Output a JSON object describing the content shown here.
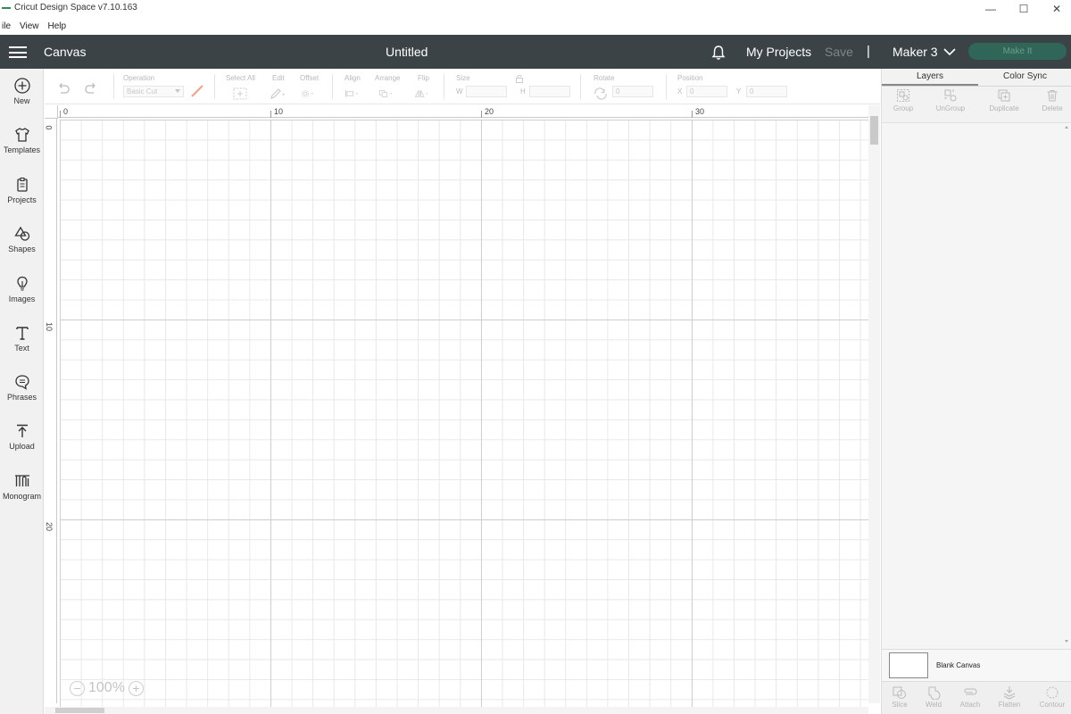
{
  "window": {
    "title": "Cricut Design Space  v7.10.163",
    "controls": [
      "—",
      "☐",
      "✕"
    ]
  },
  "menu": {
    "items": [
      "ile",
      "View",
      "Help"
    ]
  },
  "header": {
    "section": "Canvas",
    "project_name": "Untitled",
    "my_projects": "My Projects",
    "save": "Save",
    "separator": "|",
    "machine": "Maker 3",
    "make_it": "Make It",
    "colors": {
      "bar": "#3c4347",
      "make_it_bg": "#2f6657"
    }
  },
  "sidebar": {
    "items": [
      {
        "label": "New",
        "icon": "plus-circle-icon"
      },
      {
        "label": "Templates",
        "icon": "tshirt-icon"
      },
      {
        "label": "Projects",
        "icon": "clipboard-icon"
      },
      {
        "label": "Shapes",
        "icon": "shapes-icon"
      },
      {
        "label": "Images",
        "icon": "lightbulb-icon"
      },
      {
        "label": "Text",
        "icon": "text-icon"
      },
      {
        "label": "Phrases",
        "icon": "speech-bubble-icon"
      },
      {
        "label": "Upload",
        "icon": "upload-icon"
      },
      {
        "label": "Monogram",
        "icon": "monogram-icon"
      }
    ]
  },
  "toolbar": {
    "operation_label": "Operation",
    "operation_value": "Basic Cut",
    "select_all": "Select All",
    "edit": "Edit",
    "offset": "Offset",
    "align": "Align",
    "arrange": "Arrange",
    "flip": "Flip",
    "size": "Size",
    "size_w": "W",
    "size_h": "H",
    "rotate": "Rotate",
    "rotate_value": "0",
    "position": "Position",
    "pos_x": "X",
    "pos_y": "Y",
    "pos_x_value": "0",
    "pos_y_value": "0"
  },
  "canvas": {
    "ruler_top": [
      "0",
      "10",
      "20",
      "30"
    ],
    "ruler_left": [
      "0",
      "10",
      "20"
    ],
    "zoom": "100%"
  },
  "right_panel": {
    "tabs": [
      "Layers",
      "Color Sync"
    ],
    "actions": [
      "Group",
      "UnGroup",
      "Duplicate",
      "Delete"
    ],
    "blank_canvas": "Blank Canvas",
    "bottom_actions": [
      "Slice",
      "Weld",
      "Attach",
      "Flatten",
      "Contour"
    ]
  }
}
